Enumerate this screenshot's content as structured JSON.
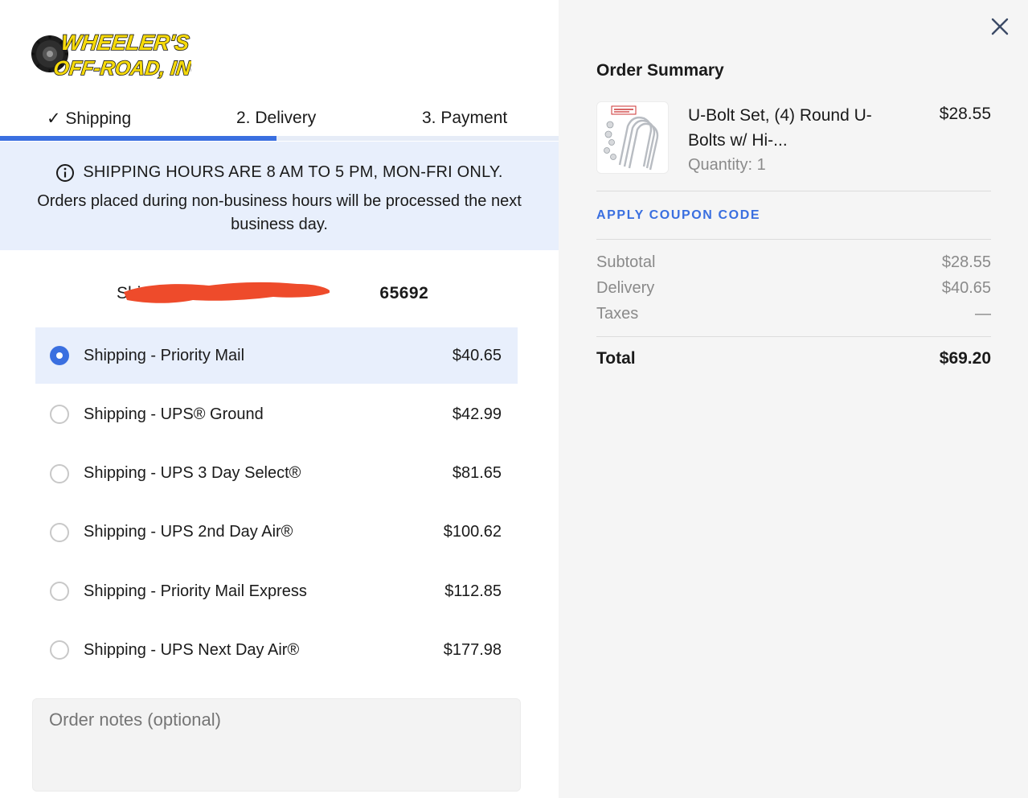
{
  "brand": {
    "logo_line1": "WHEELER'S",
    "logo_line2": "OFF-ROAD, INC.",
    "logo_colors": {
      "text": "#f5d90a",
      "outline": "#1a1a1a"
    }
  },
  "steps": [
    {
      "label": "✓ Shipping",
      "state": "complete"
    },
    {
      "label": "2. Delivery",
      "state": "current"
    },
    {
      "label": "3. Payment",
      "state": "upcoming"
    }
  ],
  "step_progress": 0.5,
  "banner": {
    "icon": "info-circle-icon",
    "line1": "SHIPPING HOURS ARE 8 AM TO 5 PM, MON-FRI ONLY.",
    "line2": "Orders placed during non-business hours will be processed the next business day."
  },
  "ship_to": {
    "label": "Ship to",
    "zip": "65692",
    "redacted": true
  },
  "shipping_options": [
    {
      "label": "Shipping - Priority Mail",
      "price": "$40.65",
      "selected": true
    },
    {
      "label": "Shipping - UPS® Ground",
      "price": "$42.99",
      "selected": false
    },
    {
      "label": "Shipping - UPS 3 Day Select®",
      "price": "$81.65",
      "selected": false
    },
    {
      "label": "Shipping - UPS 2nd Day Air®",
      "price": "$100.62",
      "selected": false
    },
    {
      "label": "Shipping - Priority Mail Express",
      "price": "$112.85",
      "selected": false
    },
    {
      "label": "Shipping - UPS Next Day Air®",
      "price": "$177.98",
      "selected": false
    }
  ],
  "notes": {
    "placeholder": "Order notes (optional)",
    "value": ""
  },
  "summary": {
    "title": "Order Summary",
    "item": {
      "name": "U-Bolt Set, (4) Round U-Bolts w/ Hi-...",
      "quantity": "Quantity: 1",
      "price": "$28.55"
    },
    "coupon_label": "APPLY COUPON CODE",
    "subtotal_label": "Subtotal",
    "subtotal_value": "$28.55",
    "delivery_label": "Delivery",
    "delivery_value": "$40.65",
    "taxes_label": "Taxes",
    "taxes_value": "—",
    "total_label": "Total",
    "total_value": "$69.20"
  },
  "colors": {
    "accent": "#3a6fe0",
    "selected_bg": "#e8effc",
    "summary_bg": "#f5f5f5",
    "redaction": "#ee4b2b"
  }
}
